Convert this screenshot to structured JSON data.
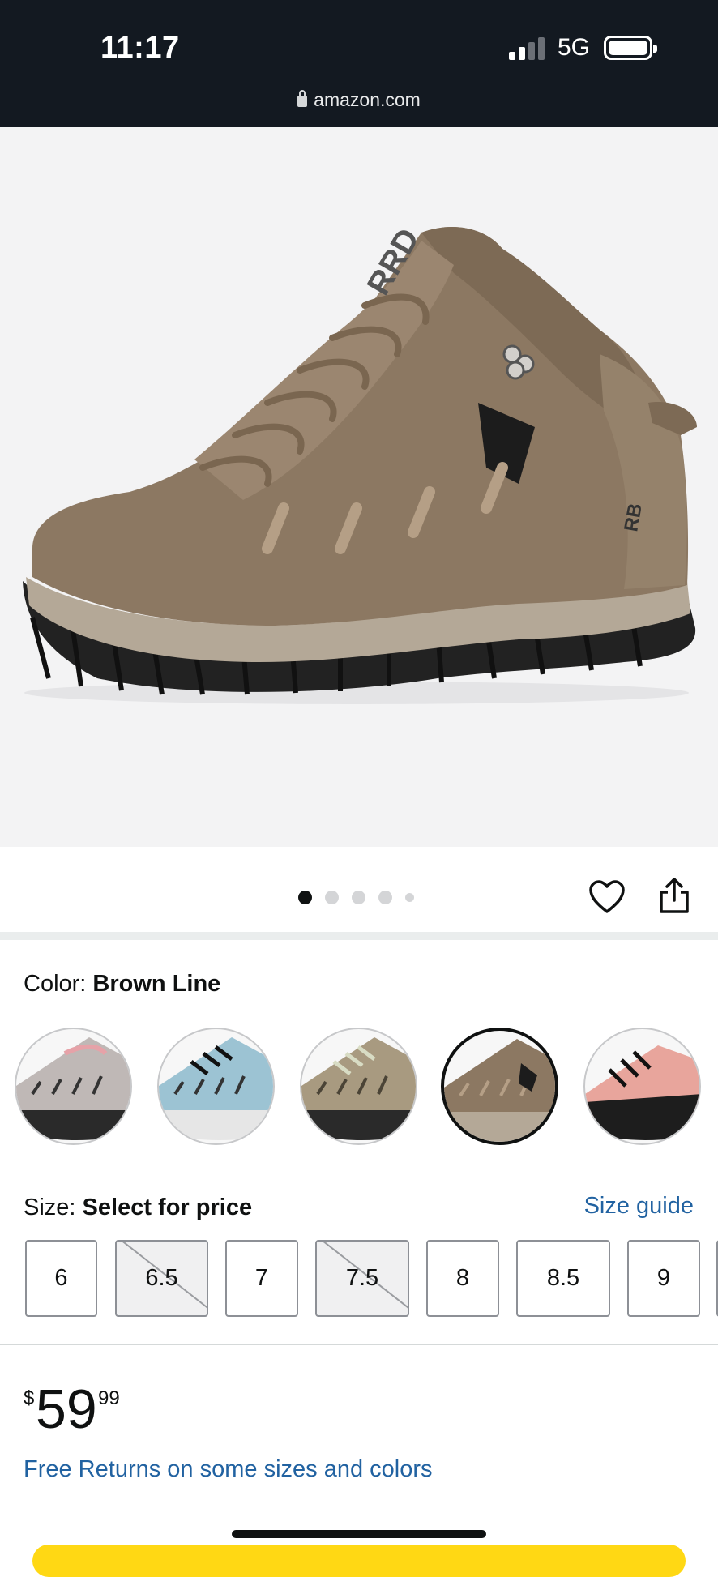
{
  "status_bar": {
    "time": "11:17",
    "network": "5G",
    "url": "amazon.com"
  },
  "product": {
    "image_alt": "Brown hiking boot",
    "carousel": {
      "count": 5,
      "active_index": 0
    },
    "color": {
      "label": "Color:",
      "selected": "Brown Line",
      "swatches": [
        {
          "name": "grey-swatch",
          "selected": false
        },
        {
          "name": "light-blue-swatch",
          "selected": false
        },
        {
          "name": "khaki-swatch",
          "selected": false
        },
        {
          "name": "brown-line-swatch",
          "selected": true
        },
        {
          "name": "pink-black-swatch",
          "selected": false
        }
      ]
    },
    "size": {
      "label": "Size:",
      "selected": "Select for price",
      "guide_link": "Size guide",
      "options": [
        {
          "label": "6",
          "available": true
        },
        {
          "label": "6.5",
          "available": false
        },
        {
          "label": "7",
          "available": true
        },
        {
          "label": "7.5",
          "available": false
        },
        {
          "label": "8",
          "available": true
        },
        {
          "label": "8.5",
          "available": true
        },
        {
          "label": "9",
          "available": true
        }
      ]
    },
    "price": {
      "symbol": "$",
      "whole": "59",
      "fraction": "99"
    },
    "returns_link": "Free Returns on some sizes and colors"
  },
  "colors": {
    "header_bg": "#131921",
    "link": "#2162a1",
    "buy_button": "#ffd814"
  }
}
